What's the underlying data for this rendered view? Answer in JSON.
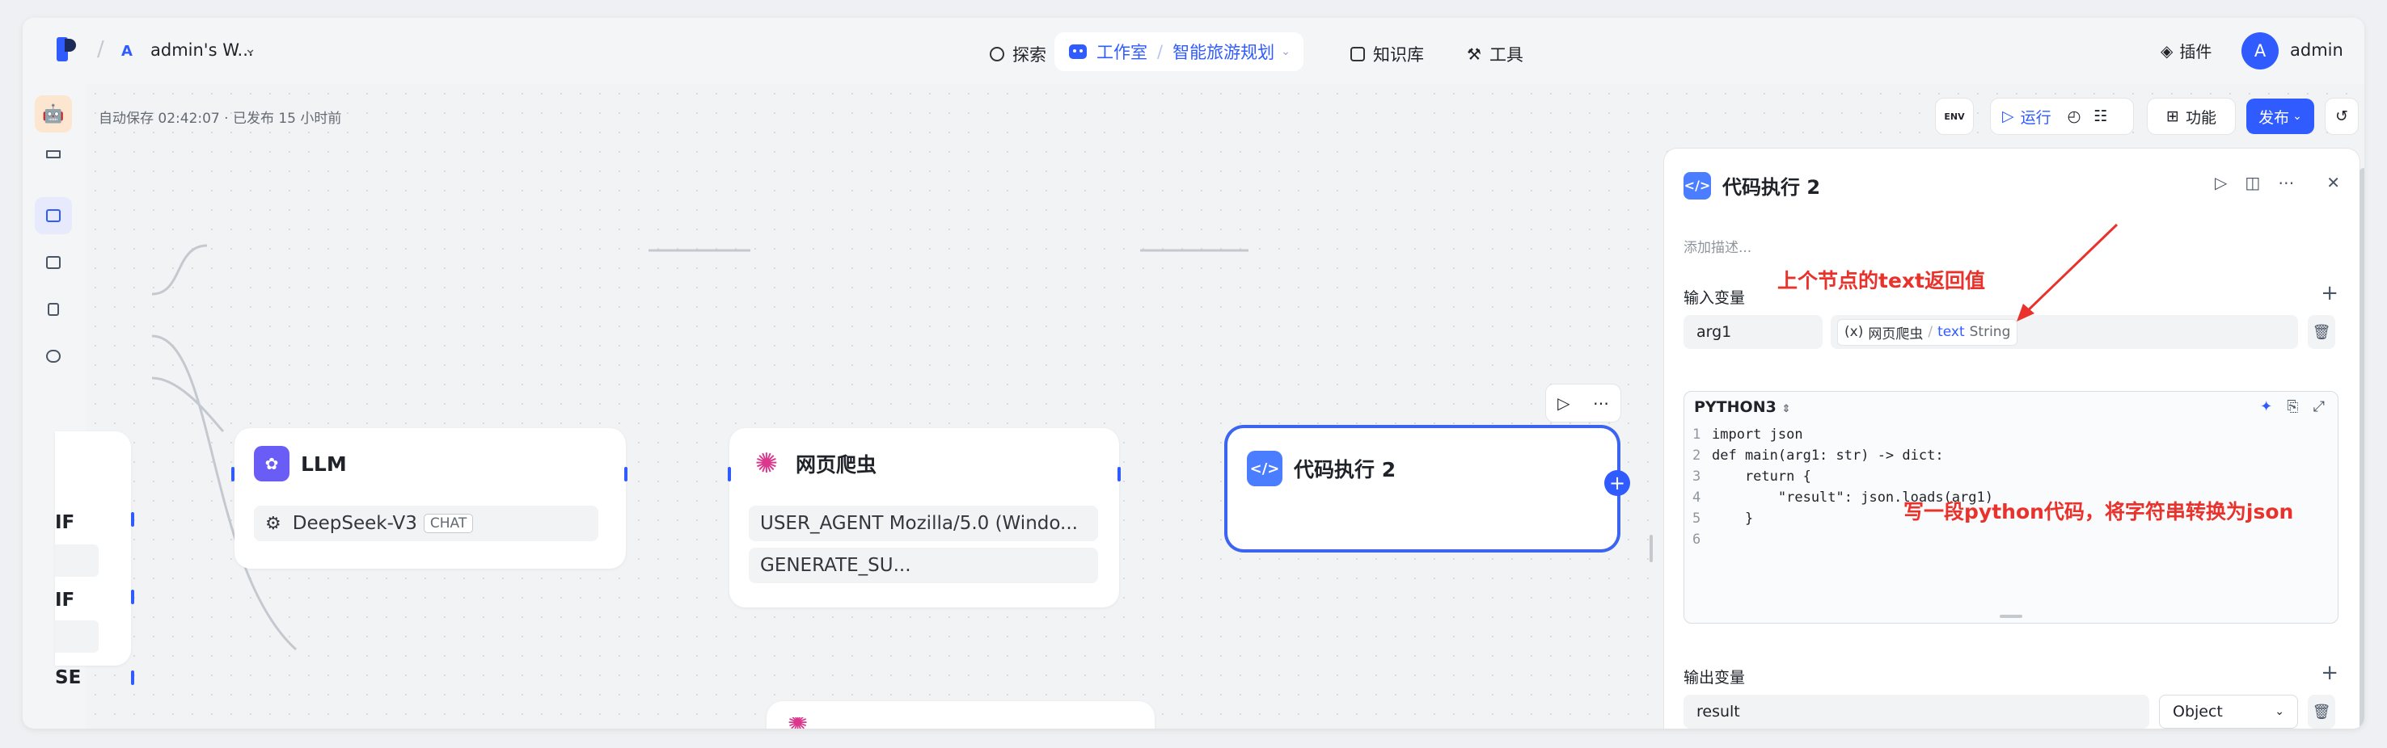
{
  "topbar": {
    "workspace_badge": "A",
    "workspace_name": "admin's W...",
    "nav_explore": "探索",
    "nav_studio": "工作室",
    "nav_app": "智能旅游规划",
    "nav_knowledge": "知识库",
    "nav_tools": "工具",
    "plugin": "插件",
    "avatar_letter": "A",
    "user_name": "admin"
  },
  "toolbar": {
    "autosave": "自动保存 02:42:07 · 已发布 15 小时前",
    "env_label": "ENV",
    "run_label": "运行",
    "features_label": "功能",
    "publish_label": "发布"
  },
  "nodes": {
    "partial": {
      "line1": "IF",
      "line2": "IF",
      "line3": "SE"
    },
    "llm": {
      "title": "LLM",
      "model": "DeepSeek-V3",
      "tag": "CHAT"
    },
    "crawler": {
      "title": "网页爬虫",
      "field1": "USER_AGENT Mozilla/5.0 (Windo...",
      "field2": "GENERATE_SU..."
    },
    "code": {
      "title": "代码执行 2"
    }
  },
  "panel": {
    "title": "代码执行 2",
    "description_placeholder": "添加描述...",
    "input_label": "输入变量",
    "input_var_name": "arg1",
    "ref_node": "网页爬虫",
    "ref_sep": "/",
    "ref_var": "text",
    "ref_type": "String",
    "language": "PYTHON3",
    "code_lines": [
      {
        "n": "1",
        "text": "import json"
      },
      {
        "n": "2",
        "text": "def main(arg1: str) -> dict:"
      },
      {
        "n": "3",
        "text": "    return {"
      },
      {
        "n": "4",
        "text": "        \"result\": json.loads(arg1)"
      },
      {
        "n": "5",
        "text": "    }"
      },
      {
        "n": "6",
        "text": ""
      }
    ],
    "output_label": "输出变量",
    "output_var_name": "result",
    "output_type": "Object"
  },
  "annotations": {
    "a1": "上个节点的text返回值",
    "a2": "写一段python代码，将字符串转换为json"
  },
  "colors": {
    "accent": "#2f5bff",
    "annotation": "#e8322b"
  }
}
